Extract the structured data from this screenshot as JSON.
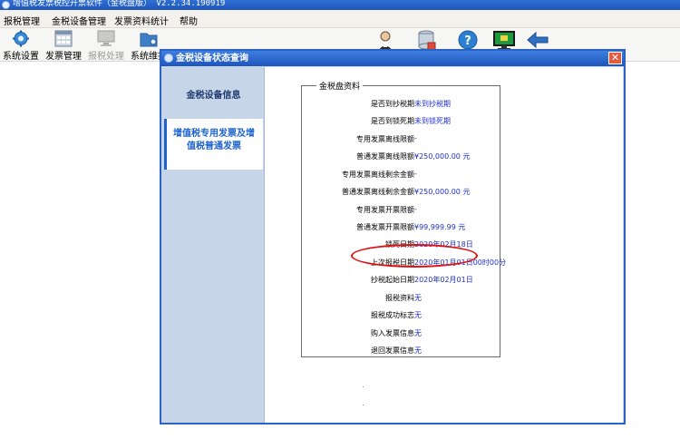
{
  "app": {
    "title": "增值税发票税控开票软件（金税盘版） V2.2.34.190919"
  },
  "menu": [
    "报税管理",
    "金税设备管理",
    "发票资料统计",
    "帮助"
  ],
  "toolbar": {
    "buttons": [
      {
        "label": "系统设置",
        "icon": "gear-icon",
        "disabled": false
      },
      {
        "label": "发票管理",
        "icon": "invoice-icon",
        "disabled": false
      },
      {
        "label": "报税处理",
        "icon": "monitor-icon",
        "disabled": true
      },
      {
        "label": "系统维护",
        "icon": "folder-gear-icon",
        "disabled": false
      }
    ],
    "right_icons": [
      "user-icon",
      "database-icon",
      "help-icon",
      "screen-icon",
      "back-arrow-icon"
    ]
  },
  "dialog": {
    "title": "金税设备状态查询",
    "close_label": "✕",
    "nav": [
      {
        "label": "金税设备信息",
        "active": false
      },
      {
        "label": "增值税专用发票及增值税普通发票",
        "active": true
      }
    ],
    "group_title": "金税盘资料",
    "rows": [
      {
        "label": "是否到抄税期",
        "value": "未到抄税期"
      },
      {
        "label": "是否到锁死期",
        "value": "未到锁死期"
      },
      {
        "label": "专用发票离线限额",
        "value": "-"
      },
      {
        "label": "普通发票离线限额",
        "value": "¥250,000.00 元"
      },
      {
        "label": "专用发票离线剩余金额",
        "value": "-"
      },
      {
        "label": "普通发票离线剩余金额",
        "value": "¥250,000.00 元"
      },
      {
        "label": "专用发票开票限额",
        "value": "-"
      },
      {
        "label": "普通发票开票限额",
        "value": "¥99,999.99 元"
      },
      {
        "label": "锁死日期",
        "value": "2020年02月18日"
      },
      {
        "label": "上次报税日期",
        "value": "2020年01月01日00时00分"
      },
      {
        "label": "抄税起始日期",
        "value": "2020年02月01日"
      },
      {
        "label": "报税资料",
        "value": "无"
      },
      {
        "label": "报税成功标志",
        "value": "无"
      },
      {
        "label": "购入发票信息",
        "value": "无"
      },
      {
        "label": "退回发票信息",
        "value": "无"
      }
    ]
  },
  "colors": {
    "title_bar": "#1f56b8",
    "dialog_bg": "#c9d6ea",
    "value_text": "#1f2fd0",
    "highlight": "#e01010",
    "active_tab": "#1d63cf"
  }
}
